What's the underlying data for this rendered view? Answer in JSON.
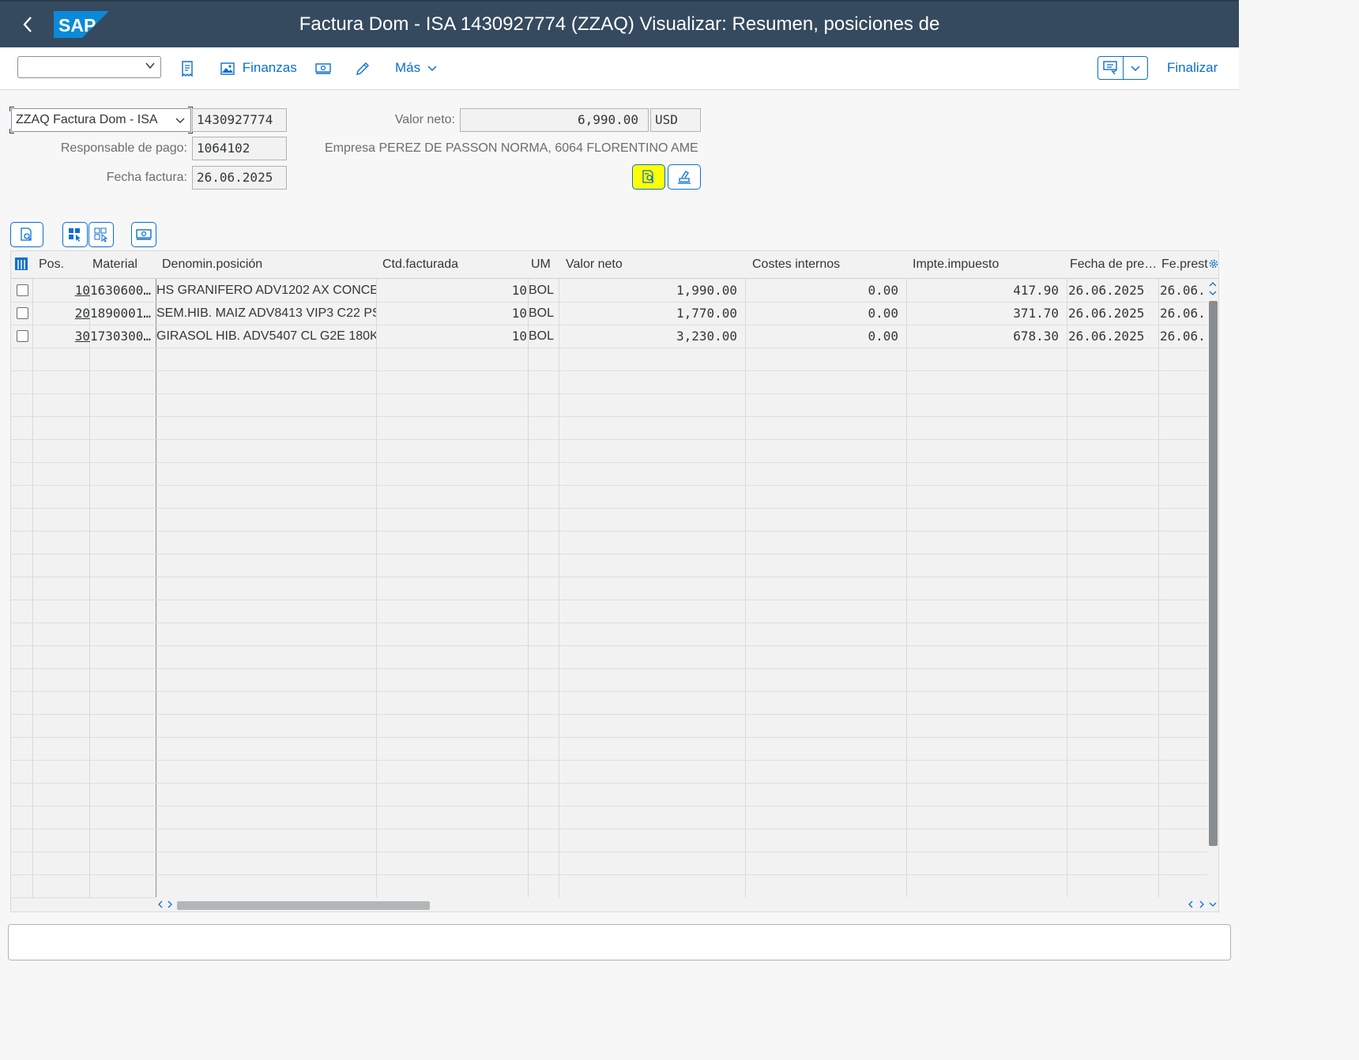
{
  "shell": {
    "title": "Factura Dom - ISA 1430927774 (ZZAQ) Visualizar: Resumen, posiciones de",
    "logo_text": "SAP"
  },
  "toolbar": {
    "select_value": "",
    "finanzas_label": "Finanzas",
    "mas_label": "Más",
    "finalizar_label": "Finalizar"
  },
  "header": {
    "doc_type": "ZZAQ Factura Dom - ISA",
    "doc_number": "1430927774",
    "valor_neto_label": "Valor neto:",
    "valor_neto": "6,990.00",
    "currency": "USD",
    "responsable_label": "Responsable de pago:",
    "responsable": "1064102",
    "empresa_text": "Empresa PEREZ DE PASSON NORMA, 6064 FLORENTINO AME…",
    "fecha_label": "Fecha factura:",
    "fecha": "26.06.2025"
  },
  "table": {
    "columns": [
      "Pos.",
      "Material",
      "Denomin.posición",
      "Ctd.facturada",
      "UM",
      "Valor neto",
      "Costes internos",
      "Impte.impuesto",
      "Fecha de pre…",
      "Fe.prest"
    ],
    "rows": [
      {
        "pos": "10",
        "material": "1630600…",
        "denom": "HS GRANIFERO ADV1202 AX CONCE…",
        "ctd": "10",
        "um": "BOL",
        "valor": "1,990.00",
        "costes": "0.00",
        "impuesto": "417.90",
        "fecha_pre": "26.06.2025",
        "fe_prest": "26.06."
      },
      {
        "pos": "20",
        "material": "1890001…",
        "denom": "SEM.HIB. MAIZ ADV8413 VIP3 C22 PS",
        "ctd": "10",
        "um": "BOL",
        "valor": "1,770.00",
        "costes": "0.00",
        "impuesto": "371.70",
        "fecha_pre": "26.06.2025",
        "fe_prest": "26.06."
      },
      {
        "pos": "30",
        "material": "1730300…",
        "denom": "GIRASOL HIB. ADV5407 CL G2E 180K…",
        "ctd": "10",
        "um": "BOL",
        "valor": "3,230.00",
        "costes": "0.00",
        "impuesto": "678.30",
        "fecha_pre": "26.06.2025",
        "fe_prest": "26.06."
      }
    ]
  },
  "colors": {
    "shell_bg": "#354a5f",
    "accent": "#0a6ed1",
    "highlight": "#ffff00"
  }
}
